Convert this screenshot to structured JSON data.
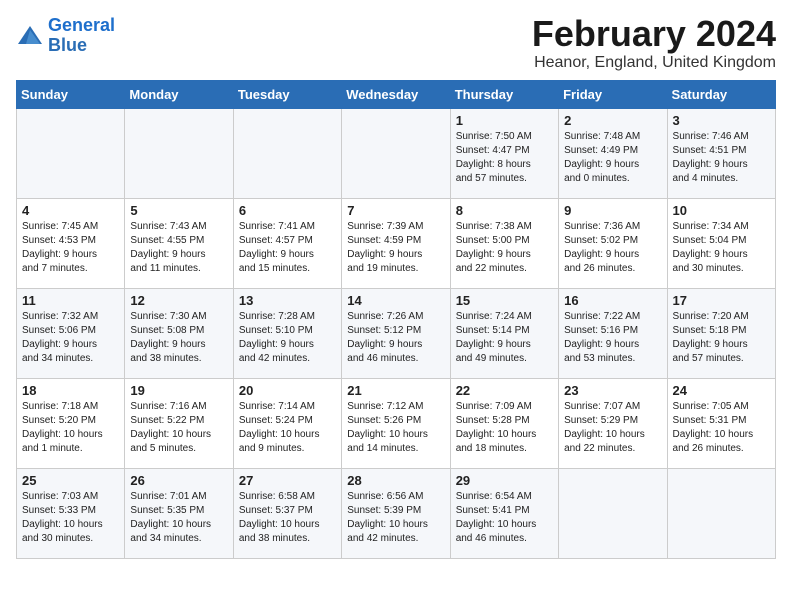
{
  "logo": {
    "line1": "General",
    "line2": "Blue"
  },
  "title": "February 2024",
  "location": "Heanor, England, United Kingdom",
  "days_header": [
    "Sunday",
    "Monday",
    "Tuesday",
    "Wednesday",
    "Thursday",
    "Friday",
    "Saturday"
  ],
  "weeks": [
    [
      {
        "num": "",
        "info": ""
      },
      {
        "num": "",
        "info": ""
      },
      {
        "num": "",
        "info": ""
      },
      {
        "num": "",
        "info": ""
      },
      {
        "num": "1",
        "info": "Sunrise: 7:50 AM\nSunset: 4:47 PM\nDaylight: 8 hours\nand 57 minutes."
      },
      {
        "num": "2",
        "info": "Sunrise: 7:48 AM\nSunset: 4:49 PM\nDaylight: 9 hours\nand 0 minutes."
      },
      {
        "num": "3",
        "info": "Sunrise: 7:46 AM\nSunset: 4:51 PM\nDaylight: 9 hours\nand 4 minutes."
      }
    ],
    [
      {
        "num": "4",
        "info": "Sunrise: 7:45 AM\nSunset: 4:53 PM\nDaylight: 9 hours\nand 7 minutes."
      },
      {
        "num": "5",
        "info": "Sunrise: 7:43 AM\nSunset: 4:55 PM\nDaylight: 9 hours\nand 11 minutes."
      },
      {
        "num": "6",
        "info": "Sunrise: 7:41 AM\nSunset: 4:57 PM\nDaylight: 9 hours\nand 15 minutes."
      },
      {
        "num": "7",
        "info": "Sunrise: 7:39 AM\nSunset: 4:59 PM\nDaylight: 9 hours\nand 19 minutes."
      },
      {
        "num": "8",
        "info": "Sunrise: 7:38 AM\nSunset: 5:00 PM\nDaylight: 9 hours\nand 22 minutes."
      },
      {
        "num": "9",
        "info": "Sunrise: 7:36 AM\nSunset: 5:02 PM\nDaylight: 9 hours\nand 26 minutes."
      },
      {
        "num": "10",
        "info": "Sunrise: 7:34 AM\nSunset: 5:04 PM\nDaylight: 9 hours\nand 30 minutes."
      }
    ],
    [
      {
        "num": "11",
        "info": "Sunrise: 7:32 AM\nSunset: 5:06 PM\nDaylight: 9 hours\nand 34 minutes."
      },
      {
        "num": "12",
        "info": "Sunrise: 7:30 AM\nSunset: 5:08 PM\nDaylight: 9 hours\nand 38 minutes."
      },
      {
        "num": "13",
        "info": "Sunrise: 7:28 AM\nSunset: 5:10 PM\nDaylight: 9 hours\nand 42 minutes."
      },
      {
        "num": "14",
        "info": "Sunrise: 7:26 AM\nSunset: 5:12 PM\nDaylight: 9 hours\nand 46 minutes."
      },
      {
        "num": "15",
        "info": "Sunrise: 7:24 AM\nSunset: 5:14 PM\nDaylight: 9 hours\nand 49 minutes."
      },
      {
        "num": "16",
        "info": "Sunrise: 7:22 AM\nSunset: 5:16 PM\nDaylight: 9 hours\nand 53 minutes."
      },
      {
        "num": "17",
        "info": "Sunrise: 7:20 AM\nSunset: 5:18 PM\nDaylight: 9 hours\nand 57 minutes."
      }
    ],
    [
      {
        "num": "18",
        "info": "Sunrise: 7:18 AM\nSunset: 5:20 PM\nDaylight: 10 hours\nand 1 minute."
      },
      {
        "num": "19",
        "info": "Sunrise: 7:16 AM\nSunset: 5:22 PM\nDaylight: 10 hours\nand 5 minutes."
      },
      {
        "num": "20",
        "info": "Sunrise: 7:14 AM\nSunset: 5:24 PM\nDaylight: 10 hours\nand 9 minutes."
      },
      {
        "num": "21",
        "info": "Sunrise: 7:12 AM\nSunset: 5:26 PM\nDaylight: 10 hours\nand 14 minutes."
      },
      {
        "num": "22",
        "info": "Sunrise: 7:09 AM\nSunset: 5:28 PM\nDaylight: 10 hours\nand 18 minutes."
      },
      {
        "num": "23",
        "info": "Sunrise: 7:07 AM\nSunset: 5:29 PM\nDaylight: 10 hours\nand 22 minutes."
      },
      {
        "num": "24",
        "info": "Sunrise: 7:05 AM\nSunset: 5:31 PM\nDaylight: 10 hours\nand 26 minutes."
      }
    ],
    [
      {
        "num": "25",
        "info": "Sunrise: 7:03 AM\nSunset: 5:33 PM\nDaylight: 10 hours\nand 30 minutes."
      },
      {
        "num": "26",
        "info": "Sunrise: 7:01 AM\nSunset: 5:35 PM\nDaylight: 10 hours\nand 34 minutes."
      },
      {
        "num": "27",
        "info": "Sunrise: 6:58 AM\nSunset: 5:37 PM\nDaylight: 10 hours\nand 38 minutes."
      },
      {
        "num": "28",
        "info": "Sunrise: 6:56 AM\nSunset: 5:39 PM\nDaylight: 10 hours\nand 42 minutes."
      },
      {
        "num": "29",
        "info": "Sunrise: 6:54 AM\nSunset: 5:41 PM\nDaylight: 10 hours\nand 46 minutes."
      },
      {
        "num": "",
        "info": ""
      },
      {
        "num": "",
        "info": ""
      }
    ]
  ]
}
